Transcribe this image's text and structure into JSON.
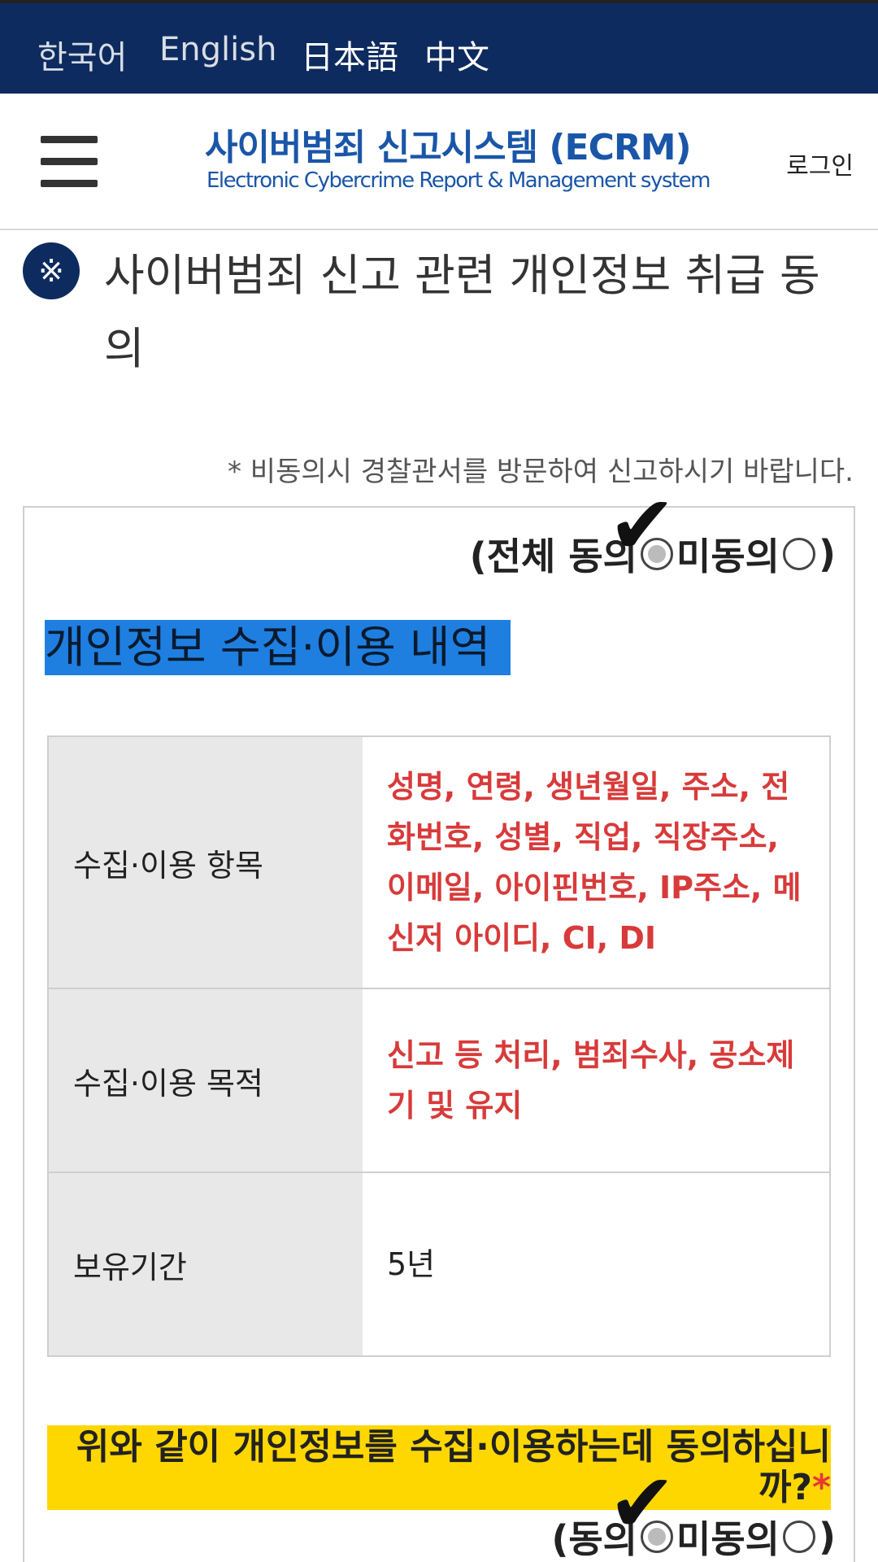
{
  "languages": [
    "한국어",
    "English",
    "日本語",
    "中文"
  ],
  "header": {
    "title": "사이버범죄 신고시스템 (ECRM)",
    "subtitle": "Electronic Cybercrime Report & Management system",
    "login_label": "로그인"
  },
  "page": {
    "icon_glyph": "※",
    "title": "사이버범죄 신고 관련 개인정보 취급 동의",
    "notice": "* 비동의시 경찰관서를 방문하여 신고하시기 바랍니다."
  },
  "agree_all": {
    "open": "(전체 동의",
    "disagree": "미동의",
    "close": ")",
    "selected": "동의"
  },
  "section": {
    "heading": "개인정보 수집·이용 내역"
  },
  "table": {
    "rows": [
      {
        "label": "수집·이용 항목",
        "value": "성명, 연령, 생년월일, 주소, 전화번호, 성별, 직업, 직장주소, 이메일, 아이핀번호, IP주소, 메신저 아이디, CI, DI"
      },
      {
        "label": "수집·이용 목적",
        "value": "신고 등 처리, 범죄수사, 공소제기 및 유지"
      },
      {
        "label": "보유기간",
        "value": "5년"
      }
    ]
  },
  "question": {
    "text": "위와 같이 개인정보를 수집·이용하는데 동의하십니까?",
    "required_mark": "*"
  },
  "agree_q": {
    "open": "(동의",
    "disagree": "미동의",
    "close": ")",
    "selected": "동의"
  },
  "colors": {
    "topbar": "#0d2b5e",
    "brand": "#1a56a8",
    "heading_highlight": "#1e7fe0",
    "question_highlight": "#ffd700",
    "required": "#d83a3a"
  }
}
